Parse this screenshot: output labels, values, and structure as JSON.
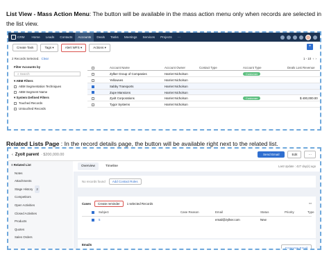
{
  "section1": {
    "heading": "List View - Mass Action Menu",
    "text": ": The button will be available in the mass action menu only when records are selected in the list view."
  },
  "section2": {
    "heading": "Related Lists Page",
    "text": " : In the record details page, the button will be available right next to the related list."
  },
  "crm": {
    "logo": "CRM",
    "nav": [
      "Home",
      "Leads",
      "Contacts",
      "Accounts",
      "Deals",
      "Tasks",
      "Meetings",
      "Services",
      "Projects",
      "···"
    ],
    "active_nav": "Accounts",
    "toolbar": {
      "create_task": "Create Task",
      "tags": "Tags",
      "alert": "Alert WFS",
      "actions": "Actions"
    },
    "records_selected": "2 Records Selected.",
    "clear": "Clear",
    "pagination": "1 - 10",
    "sidebar": {
      "filter_heading": "Filter Accounts by",
      "search_placeholder": "Search",
      "abm_heading": "ABM Filters",
      "abm_items": [
        "ABM Segmentation Techniques",
        "ABM Segment Name"
      ],
      "sys_heading": "System Defined Filters",
      "sys_items": [
        "Touched Records",
        "Untouched Records"
      ]
    },
    "columns": [
      "Account Name",
      "Account Owner",
      "Contact Type",
      "Account Type",
      "Deals Lost Revenue"
    ],
    "rows": [
      {
        "name": "Zylker Group of Companies",
        "owner": "Harriet Nicholson",
        "type": "Customer",
        "revenue": "",
        "checked": false
      },
      {
        "name": "Yellowves",
        "owner": "Harriet Nicholson",
        "type": "",
        "revenue": "",
        "checked": false
      },
      {
        "name": "Sabby Transports",
        "owner": "Harriet Nicholson",
        "type": "",
        "revenue": "",
        "checked": true
      },
      {
        "name": "Zupe Mansions",
        "owner": "Harriet Nicholson",
        "type": "",
        "revenue": "",
        "checked": true
      },
      {
        "name": "Zyolt Corporations",
        "owner": "Harriet Nicholson",
        "type": "Customer",
        "revenue": "$ 400,000.00",
        "checked": false
      },
      {
        "name": "Tygor Systems",
        "owner": "Harriet Nicholson",
        "type": "",
        "revenue": "",
        "checked": false
      }
    ]
  },
  "deal": {
    "back": "‹",
    "name": "Zyolt parent",
    "amount": "· $200,000.00",
    "send_email": "Send Email",
    "edit": "Edit",
    "more": "···",
    "sidebar_heading": "Related List",
    "sidebar_items": [
      "Notes",
      "Attachments",
      "Stage History",
      "Competitors",
      "Open Activities",
      "Closed Activities",
      "Products",
      "Quotes",
      "Sales Orders"
    ],
    "stage_badge": "2",
    "tabs": [
      "Overview",
      "Timeline"
    ],
    "last_update": "Last Update : 427 day(s) ago",
    "no_roles": "No records found",
    "add_roles": "Add Contact Roles",
    "cases_label": "Cases",
    "reminder": "Create reminder",
    "cases_count": "1 selected Records",
    "case_cols": [
      "Subject",
      "Case Reason",
      "Email",
      "Status",
      "Priority",
      "Type"
    ],
    "case_row": {
      "subject": "5",
      "email": "email@zylker.com",
      "status": "New"
    },
    "emails_label": "Emails",
    "compose": "Compose Email"
  },
  "colors": {
    "nav": "#1c3352",
    "accent": "#2f6fd0",
    "highlight": "#d9534f",
    "customer": "#5cbf7f"
  }
}
